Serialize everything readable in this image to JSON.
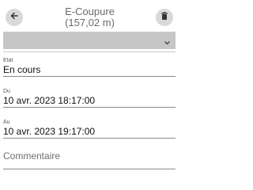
{
  "header": {
    "title": "E-Coupure",
    "subtitle": "(157,02 m)",
    "back_icon": "arrow-left-icon",
    "delete_icon": "trash-icon"
  },
  "select": {
    "value": "",
    "icon": "chevron-down-icon"
  },
  "fields": {
    "etat": {
      "label": "Etat",
      "value": "En cours"
    },
    "du": {
      "label": "Du",
      "value": "10 avr. 2023 18:17:00"
    },
    "au": {
      "label": "Au",
      "value": "10 avr. 2023 19:17:00"
    }
  },
  "comment": {
    "placeholder": "Commentaire"
  },
  "colors": {
    "button_bg": "#d9d9d9",
    "select_bg": "#c6c6c6",
    "title": "#6b6b6b"
  }
}
